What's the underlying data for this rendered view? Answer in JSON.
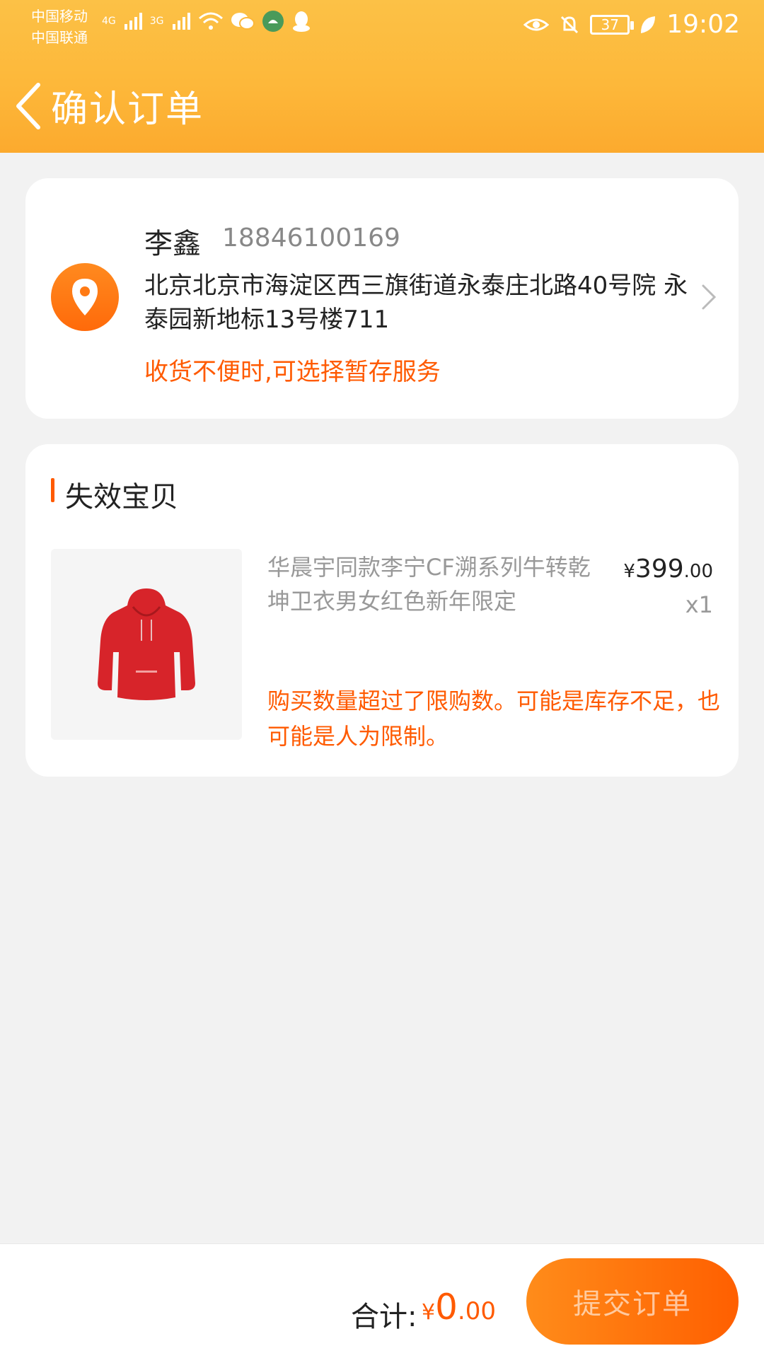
{
  "status_bar": {
    "carrier_1": "中国移动",
    "carrier_2": "中国联通",
    "net_1": "4G",
    "net_2": "3G",
    "battery": "37",
    "time": "19:02"
  },
  "nav": {
    "title": "确认订单",
    "back_icon": "chevron-left-icon"
  },
  "address": {
    "name": "李鑫",
    "phone": "18846100169",
    "detail": "北京北京市海淀区西三旗街道永泰庄北路40号院 永泰园新地标13号楼711",
    "tip": "收货不便时,可选择暂存服务",
    "icon": "location-pin-icon"
  },
  "invalid_section": {
    "title": "失效宝贝",
    "item": {
      "title": "华晨宇同款李宁CF溯系列牛转乾坤卫衣男女红色新年限定",
      "price_symbol": "¥",
      "price_int": "399",
      "price_dec": ".00",
      "qty": "x1",
      "warning": "购买数量超过了限购数。可能是库存不足，也可能是人为限制。"
    }
  },
  "footer": {
    "total_label": "合计:",
    "total_symbol": "¥",
    "total_int": "0",
    "total_dec": ".00",
    "submit_label": "提交订单"
  },
  "colors": {
    "header": "#fdb83a",
    "accent": "#ff5a00",
    "background": "#f2f2f2"
  }
}
